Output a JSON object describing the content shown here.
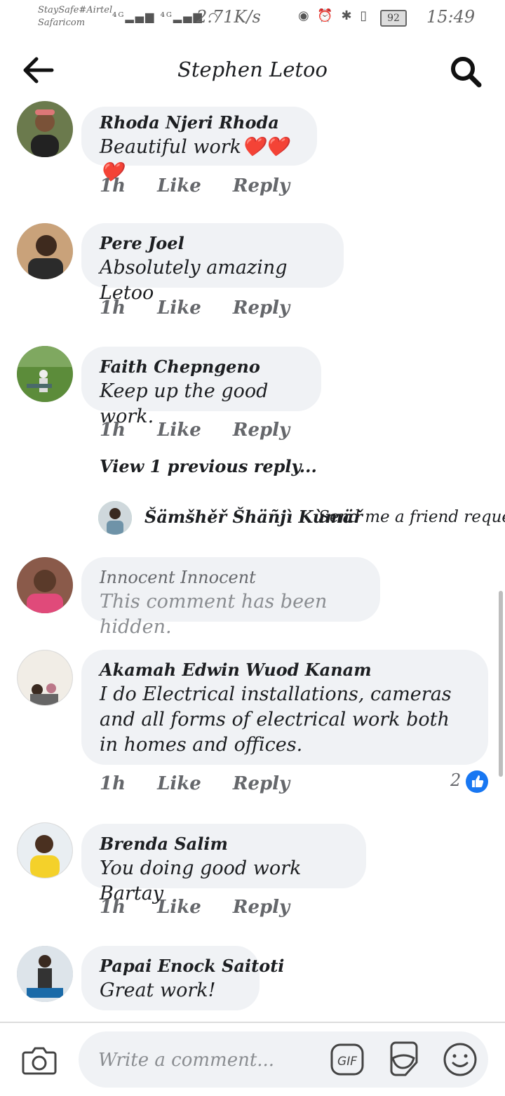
{
  "status_bar": {
    "carrier_1": "StaySafe#Airtel",
    "carrier_2": "Safaricom",
    "network_speed": "2.71K/s",
    "battery": "92",
    "time": "15:49"
  },
  "header": {
    "title": "Stephen Letoo"
  },
  "comments": [
    {
      "author": "Rhoda Njeri Rhoda",
      "text": "Beautiful work❤️❤️❤️",
      "time": "1h",
      "like": "Like",
      "reply": "Reply"
    },
    {
      "author": "Pere Joel",
      "text": "Absolutely amazing Letoo",
      "time": "1h",
      "like": "Like",
      "reply": "Reply"
    },
    {
      "author": "Faith Chepngeno",
      "text": "Keep up the good work.",
      "time": "1h",
      "like": "Like",
      "reply": "Reply",
      "view_previous": "View 1 previous reply...",
      "reply_preview": {
        "author": "Šämšhěř Šhäñjì Kùmäř",
        "text": "Send me a friend reque..."
      }
    },
    {
      "author": "Innocent Innocent",
      "text": "This comment has been hidden."
    },
    {
      "author": "Akamah Edwin Wuod Kanam",
      "text": "I do Electrical installations, cameras and all forms of electrical work both in homes and offices.",
      "time": "1h",
      "like": "Like",
      "reply": "Reply",
      "reaction_count": "2"
    },
    {
      "author": "Brenda Salim",
      "text": "You doing good work Bartay",
      "time": "1h",
      "like": "Like",
      "reply": "Reply"
    },
    {
      "author": "Papai Enock Saitoti",
      "text": "Great work!"
    }
  ],
  "composer": {
    "placeholder": "Write a comment..."
  },
  "colors": {
    "bubble": "#f0f2f5",
    "like_blue": "#1877f2",
    "meta_gray": "#65676b"
  }
}
